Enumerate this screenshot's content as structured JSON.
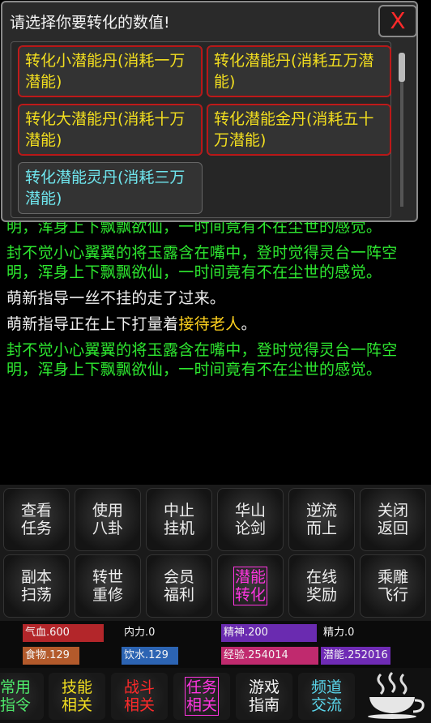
{
  "dialog": {
    "title": "请选择你要转化的数值!",
    "close_label": "X",
    "options": [
      {
        "label": "转化小潜能丹(消耗一万潜能)"
      },
      {
        "label": "转化潜能丹(消耗五万潜能)"
      },
      {
        "label": "转化大潜能丹(消耗十万潜能)"
      },
      {
        "label": "转化潜能金丹(消耗五十万潜能)"
      },
      {
        "label": "转化潜能灵丹(消耗三万潜能)"
      }
    ]
  },
  "log": {
    "line0": "封不觉小心翼翼的将玉露含在嘴中，登时觉得灵台一阵空明，浑身上下飘飘欲仙，一时间竟有不在尘世的感觉。",
    "line1": "封不觉小心翼翼的将玉露含在嘴中，登时觉得灵台一阵空明，浑身上下飘飘欲仙，一时间竟有不在尘世的感觉。",
    "line2": "萌新指导一丝不挂的走了过来。",
    "line3_pre": "萌新指导正在上下打量着",
    "line3_hl": "接待老人",
    "line3_post": "。",
    "line4": "封不觉小心翼翼的将玉露含在嘴中，登时觉得灵台一阵空明，浑身上下飘飘欲仙，一时间竟有不在尘世的感觉。"
  },
  "grid": {
    "b0": "查看任务",
    "b1": "使用八卦",
    "b2": "中止挂机",
    "b3": "华山论剑",
    "b4": "逆流而上",
    "b5": "关闭返回",
    "b6": "副本扫荡",
    "b7": "转世重修",
    "b8": "会员福利",
    "b9": "潜能转化",
    "b10": "在线奖励",
    "b11": "乘雕飞行"
  },
  "stats": {
    "qixue": "气血.600",
    "neili": "内力.0",
    "jingshen": "精神.200",
    "jingli": "精力.0",
    "shiwu": "食物.129",
    "yinshui": "饮水.129",
    "jingyan": "经验.254014",
    "qianneng": "潜能.252016",
    "colors": {
      "qixue": "#b3262a",
      "jingshen": "#6a2bb0",
      "shiwu": "#b35a2b",
      "yinshui": "#2c64b3",
      "jingyan": "#c02a6e",
      "qianneng": "#6f2bb5"
    }
  },
  "nav": {
    "n0": "常用指令",
    "n1": "技能相关",
    "n2": "战斗相关",
    "n3": "任务相关",
    "n4": "游戏指南",
    "n5": "频道交流",
    "cup_icon": "teacup-icon"
  }
}
